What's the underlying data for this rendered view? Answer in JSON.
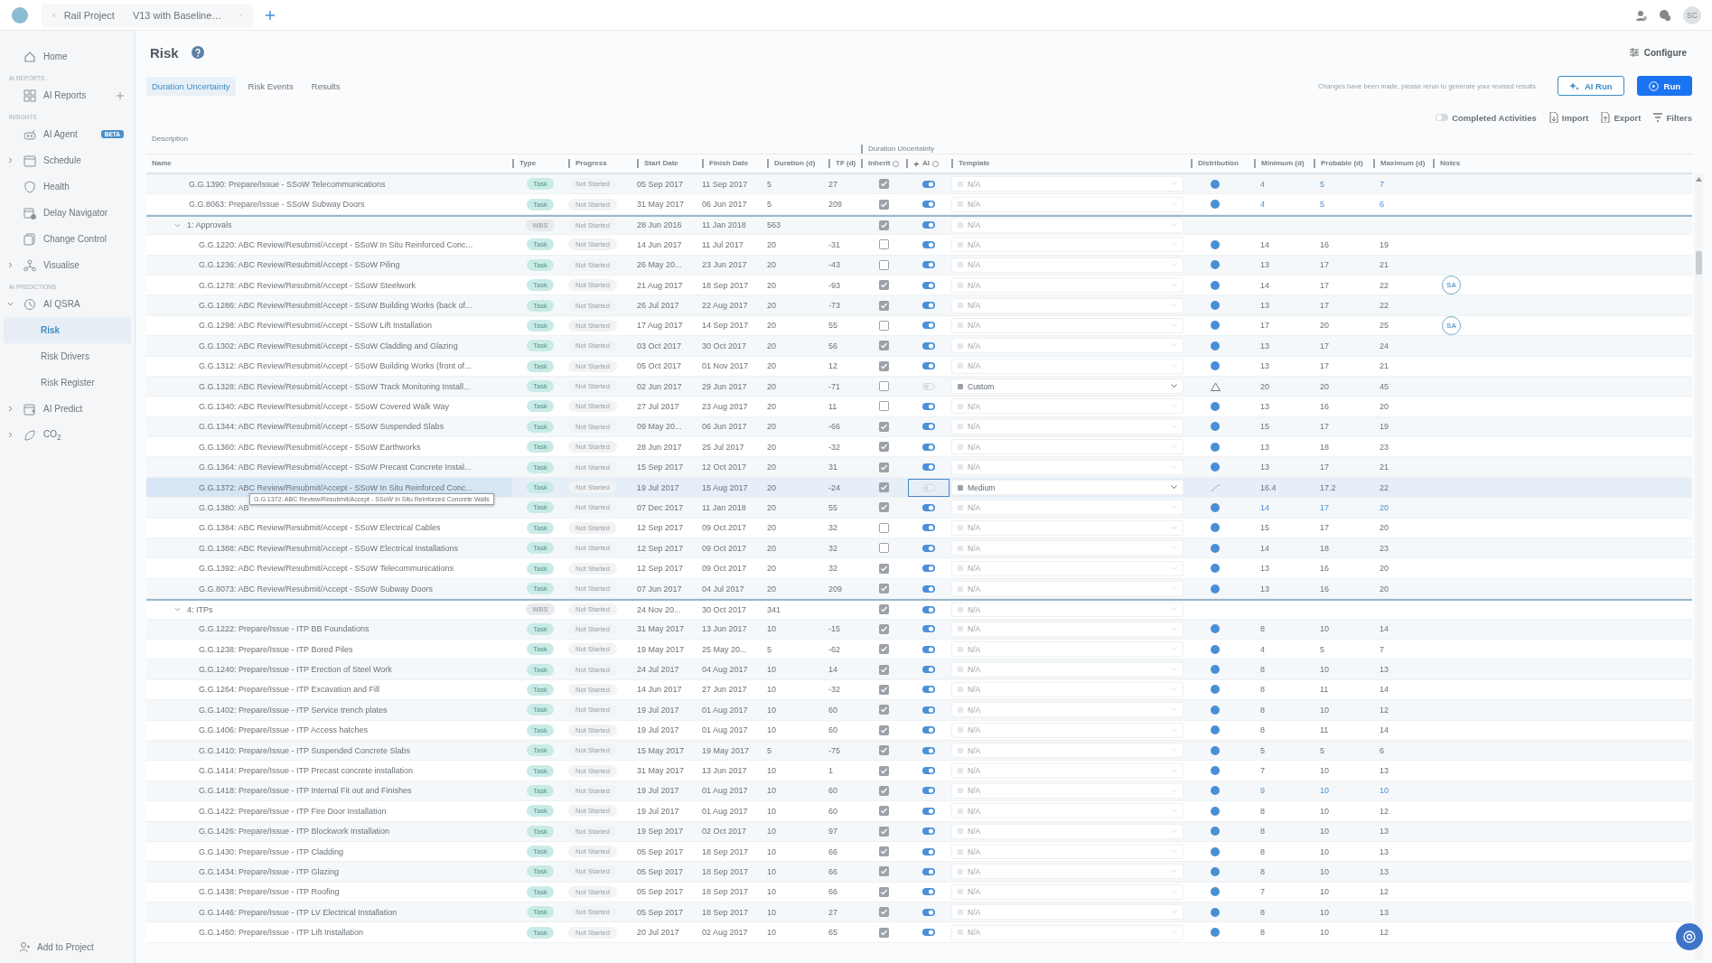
{
  "top_bar": {
    "breadcrumb": [
      "Rail Project",
      "V13 with Baseline…"
    ],
    "avatar": "SC"
  },
  "sidebar": {
    "items": [
      {
        "kind": "link",
        "label": "Home",
        "selected": false
      },
      {
        "kind": "section",
        "label": "AI REPORTS"
      },
      {
        "kind": "link",
        "label": "AI Reports",
        "selected": false,
        "add": true
      },
      {
        "kind": "section",
        "label": "INSIGHTS"
      },
      {
        "kind": "link",
        "label": "AI Agent",
        "selected": false,
        "badge": "BETA"
      },
      {
        "kind": "link",
        "label": "Schedule",
        "selected": false,
        "expanded": false
      },
      {
        "kind": "link",
        "label": "Health",
        "selected": false
      },
      {
        "kind": "link",
        "label": "Delay Navigator",
        "selected": false
      },
      {
        "kind": "link",
        "label": "Change Control",
        "selected": false
      },
      {
        "kind": "link",
        "label": "Visualise",
        "selected": false,
        "expanded": false
      },
      {
        "kind": "section",
        "label": "AI PREDICTIONS"
      },
      {
        "kind": "link",
        "label": "AI QSRA",
        "selected": false,
        "expanded": true,
        "children": [
          {
            "label": "Risk",
            "selected": true
          },
          {
            "label": "Risk Drivers",
            "selected": false
          },
          {
            "label": "Risk Register",
            "selected": false
          }
        ]
      },
      {
        "kind": "link",
        "label": "AI Predict",
        "selected": false,
        "expanded": false
      },
      {
        "kind": "link",
        "label": "CO$_{2}$",
        "selected": false,
        "expanded": false
      }
    ],
    "footer": "Add to Project"
  },
  "header": {
    "title": "Risk",
    "configure": "Configure",
    "tabs": [
      {
        "label": "Duration Uncertainty",
        "selected": true
      },
      {
        "label": "Risk Events",
        "selected": false
      },
      {
        "label": "Results",
        "selected": false
      }
    ],
    "message": "Changes have been made, please rerun to generate your revised results",
    "buttons": [
      {
        "label": "AI Run",
        "kind": "outline"
      },
      {
        "label": "Run",
        "kind": "primary"
      }
    ],
    "toolbar": {
      "completed_activities": {
        "label": "Completed Activities",
        "on": false
      },
      "actions": [
        "Import",
        "Export",
        "Filters"
      ]
    }
  },
  "table": {
    "groups": [
      "Description",
      "Duration Uncertainty"
    ],
    "columns": [
      "Name",
      "Type",
      "Progress",
      "Start Date",
      "Finish Date",
      "Duration (d)",
      "TF (d)",
      "Inherit",
      "AI",
      "Template",
      "Distribution",
      "Minimum (d)",
      "Probable (d)",
      "Maximum (d)",
      "Notes"
    ],
    "tooltip": "G.G.1372: ABC Review/Resubmit/Accept - SSoW In Situ Reinforced Concrete Walls",
    "rows": [
      {
        "kind": "task",
        "name": "G.G.1390: Prepare/Issue - SSoW Telecommunications",
        "type": "Task",
        "progress": "Not Started",
        "start": "05 Sep 2017",
        "finish": "11 Sep 2017",
        "duration": "5",
        "tf": "27",
        "inherit": true,
        "ai": true,
        "template": {
          "value": "N/A",
          "disabled": true
        },
        "distribution": {
          "kind": "normal"
        },
        "min": "4",
        "probable": "5",
        "max": "7",
        "edited": true,
        "selected": false
      },
      {
        "kind": "task",
        "name": "G.G.8063: Prepare/Issue - SSoW Subway Doors",
        "type": "Task",
        "progress": "Not Started",
        "start": "31 May 2017",
        "finish": "06 Jun 2017",
        "duration": "5",
        "tf": "209",
        "inherit": true,
        "ai": true,
        "template": {
          "value": "N/A",
          "disabled": true
        },
        "distribution": {
          "kind": "normal"
        },
        "min": "4",
        "probable": "5",
        "max": "6",
        "edited": true,
        "selected": false
      },
      {
        "kind": "wbs",
        "name": "1: Approvals",
        "type": "WBS",
        "progress": "Not Started",
        "start": "28 Jun 2016",
        "finish": "11 Jan 2018",
        "duration": "563",
        "inherit": true,
        "ai": true,
        "template": {
          "value": "N/A",
          "disabled": true
        },
        "expanded": true,
        "selected": false,
        "children": [
          {
            "kind": "task",
            "name": "G.G.1220: ABC Review/Resubmit/Accept - SSoW In Situ Reinforced Conc...",
            "type": "Task",
            "progress": "Not Started",
            "start": "14 Jun 2017",
            "finish": "11 Jul 2017",
            "duration": "20",
            "tf": "-31",
            "inherit": false,
            "ai": true,
            "template": {
              "value": "N/A",
              "disabled": true
            },
            "distribution": {
              "kind": "normal"
            },
            "min": "14",
            "probable": "16",
            "max": "19",
            "edited": false,
            "selected": false
          },
          {
            "kind": "task",
            "name": "G.G.1236: ABC Review/Resubmit/Accept - SSoW Piling",
            "type": "Task",
            "progress": "Not Started",
            "start": "26 May 20...",
            "finish": "23 Jun 2017",
            "duration": "20",
            "tf": "-43",
            "inherit": false,
            "ai": true,
            "template": {
              "value": "N/A",
              "disabled": true
            },
            "distribution": {
              "kind": "normal"
            },
            "min": "13",
            "probable": "17",
            "max": "21",
            "edited": false,
            "selected": false
          },
          {
            "kind": "task",
            "name": "G.G.1278: ABC Review/Resubmit/Accept - SSoW Steelwork",
            "type": "Task",
            "progress": "Not Started",
            "start": "21 Aug 2017",
            "finish": "18 Sep 2017",
            "duration": "20",
            "tf": "-93",
            "inherit": true,
            "ai": true,
            "template": {
              "value": "N/A",
              "disabled": true
            },
            "distribution": {
              "kind": "normal"
            },
            "min": "14",
            "probable": "17",
            "max": "22",
            "note": "SA",
            "edited": false,
            "selected": false
          },
          {
            "kind": "task",
            "name": "G.G.1286: ABC Review/Resubmit/Accept - SSoW Building Works (back of...",
            "type": "Task",
            "progress": "Not Started",
            "start": "26 Jul 2017",
            "finish": "22 Aug 2017",
            "duration": "20",
            "tf": "-73",
            "inherit": true,
            "ai": true,
            "template": {
              "value": "N/A",
              "disabled": true
            },
            "distribution": {
              "kind": "normal"
            },
            "min": "13",
            "probable": "17",
            "max": "22",
            "edited": false,
            "selected": false
          },
          {
            "kind": "task",
            "name": "G.G.1298: ABC Review/Resubmit/Accept - SSoW Lift Installation",
            "type": "Task",
            "progress": "Not Started",
            "start": "17 Aug 2017",
            "finish": "14 Sep 2017",
            "duration": "20",
            "tf": "55",
            "inherit": false,
            "ai": true,
            "template": {
              "value": "N/A",
              "disabled": true
            },
            "distribution": {
              "kind": "normal"
            },
            "min": "17",
            "probable": "20",
            "max": "25",
            "note": "SA",
            "edited": false,
            "selected": false
          },
          {
            "kind": "task",
            "name": "G.G.1302: ABC Review/Resubmit/Accept - SSoW Cladding and Glazing",
            "type": "Task",
            "progress": "Not Started",
            "start": "03 Oct 2017",
            "finish": "30 Oct 2017",
            "duration": "20",
            "tf": "56",
            "inherit": true,
            "ai": true,
            "template": {
              "value": "N/A",
              "disabled": true
            },
            "distribution": {
              "kind": "normal"
            },
            "min": "13",
            "probable": "17",
            "max": "24",
            "edited": false,
            "selected": false
          },
          {
            "kind": "task",
            "name": "G.G.1312: ABC Review/Resubmit/Accept - SSoW Building Works (front of...",
            "type": "Task",
            "progress": "Not Started",
            "start": "05 Oct 2017",
            "finish": "01 Nov 2017",
            "duration": "20",
            "tf": "12",
            "inherit": true,
            "ai": true,
            "template": {
              "value": "N/A",
              "disabled": true
            },
            "distribution": {
              "kind": "normal"
            },
            "min": "13",
            "probable": "17",
            "max": "21",
            "edited": false,
            "selected": false
          },
          {
            "kind": "task",
            "name": "G.G.1328: ABC Review/Resubmit/Accept - SSoW Track Monitoring Install...",
            "type": "Task",
            "progress": "Not Started",
            "start": "02 Jun 2017",
            "finish": "29 Jun 2017",
            "duration": "20",
            "tf": "-71",
            "inherit": false,
            "ai": false,
            "template": {
              "value": "Custom",
              "disabled": false
            },
            "distribution": {
              "kind": "triangle"
            },
            "min": "20",
            "probable": "20",
            "max": "45",
            "edited": false,
            "selected": false
          },
          {
            "kind": "task",
            "name": "G.G.1340: ABC Review/Resubmit/Accept - SSoW Covered Walk Way",
            "type": "Task",
            "progress": "Not Started",
            "start": "27 Jul 2017",
            "finish": "23 Aug 2017",
            "duration": "20",
            "tf": "11",
            "inherit": false,
            "ai": true,
            "template": {
              "value": "N/A",
              "disabled": true
            },
            "distribution": {
              "kind": "normal"
            },
            "min": "13",
            "probable": "16",
            "max": "20",
            "edited": false,
            "selected": false
          },
          {
            "kind": "task",
            "name": "G.G.1344: ABC Review/Resubmit/Accept - SSoW Suspended Slabs",
            "type": "Task",
            "progress": "Not Started",
            "start": "09 May 20...",
            "finish": "06 Jun 2017",
            "duration": "20",
            "tf": "-66",
            "inherit": true,
            "ai": true,
            "template": {
              "value": "N/A",
              "disabled": true
            },
            "distribution": {
              "kind": "normal"
            },
            "min": "15",
            "probable": "17",
            "max": "19",
            "edited": false,
            "selected": false
          },
          {
            "kind": "task",
            "name": "G.G.1360: ABC Review/Resubmit/Accept - SSoW Earthworks",
            "type": "Task",
            "progress": "Not Started",
            "start": "28 Jun 2017",
            "finish": "25 Jul 2017",
            "duration": "20",
            "tf": "-32",
            "inherit": true,
            "ai": true,
            "template": {
              "value": "N/A",
              "disabled": true
            },
            "distribution": {
              "kind": "normal"
            },
            "min": "13",
            "probable": "18",
            "max": "23",
            "edited": false,
            "selected": false
          },
          {
            "kind": "task",
            "name": "G.G.1364: ABC Review/Resubmit/Accept - SSoW Precast Concrete Instal...",
            "type": "Task",
            "progress": "Not Started",
            "start": "15 Sep 2017",
            "finish": "12 Oct 2017",
            "duration": "20",
            "tf": "31",
            "inherit": true,
            "ai": true,
            "template": {
              "value": "N/A",
              "disabled": true
            },
            "distribution": {
              "kind": "normal"
            },
            "min": "13",
            "probable": "17",
            "max": "21",
            "edited": false,
            "selected": false
          },
          {
            "kind": "task",
            "name": "G.G.1372: ABC Review/Resubmit/Accept - SSoW In Situ Reinforced Conc...",
            "type": "Task",
            "progress": "Not Started",
            "start": "19 Jul 2017",
            "finish": "15 Aug 2017",
            "duration": "20",
            "tf": "-24",
            "inherit": true,
            "ai": false,
            "template": {
              "value": "Medium",
              "disabled": false
            },
            "distribution": {
              "kind": "curve"
            },
            "min": "16.4",
            "probable": "17.2",
            "max": "22",
            "edited": false,
            "selected": true
          },
          {
            "kind": "task",
            "name": "G.G.1380: AB",
            "type": "Task",
            "progress": "Not Started",
            "start": "07 Dec 2017",
            "finish": "11 Jan 2018",
            "duration": "20",
            "tf": "55",
            "inherit": true,
            "ai": true,
            "template": {
              "value": "N/A",
              "disabled": true
            },
            "distribution": {
              "kind": "normal"
            },
            "min": "14",
            "probable": "17",
            "max": "20",
            "edited": true,
            "selected": false
          },
          {
            "kind": "task",
            "name": "G.G.1384: ABC Review/Resubmit/Accept - SSoW Electrical Cables",
            "type": "Task",
            "progress": "Not Started",
            "start": "12 Sep 2017",
            "finish": "09 Oct 2017",
            "duration": "20",
            "tf": "32",
            "inherit": false,
            "ai": true,
            "template": {
              "value": "N/A",
              "disabled": true
            },
            "distribution": {
              "kind": "normal"
            },
            "min": "15",
            "probable": "17",
            "max": "20",
            "edited": false,
            "selected": false
          },
          {
            "kind": "task",
            "name": "G.G.1388: ABC Review/Resubmit/Accept - SSoW Electrical Installations",
            "type": "Task",
            "progress": "Not Started",
            "start": "12 Sep 2017",
            "finish": "09 Oct 2017",
            "duration": "20",
            "tf": "32",
            "inherit": false,
            "ai": true,
            "template": {
              "value": "N/A",
              "disabled": true
            },
            "distribution": {
              "kind": "normal"
            },
            "min": "14",
            "probable": "18",
            "max": "23",
            "edited": false,
            "selected": false
          },
          {
            "kind": "task",
            "name": "G.G.1392: ABC Review/Resubmit/Accept - SSoW Telecommunications",
            "type": "Task",
            "progress": "Not Started",
            "start": "12 Sep 2017",
            "finish": "09 Oct 2017",
            "duration": "20",
            "tf": "32",
            "inherit": true,
            "ai": true,
            "template": {
              "value": "N/A",
              "disabled": true
            },
            "distribution": {
              "kind": "normal"
            },
            "min": "13",
            "probable": "16",
            "max": "20",
            "edited": false,
            "selected": false
          },
          {
            "kind": "task",
            "name": "G.G.8073: ABC Review/Resubmit/Accept - SSoW Subway Doors",
            "type": "Task",
            "progress": "Not Started",
            "start": "07 Jun 2017",
            "finish": "04 Jul 2017",
            "duration": "20",
            "tf": "209",
            "inherit": true,
            "ai": true,
            "template": {
              "value": "N/A",
              "disabled": true
            },
            "distribution": {
              "kind": "normal"
            },
            "min": "13",
            "probable": "16",
            "max": "20",
            "edited": false,
            "selected": false
          }
        ]
      },
      {
        "kind": "wbs",
        "name": "4: ITPs",
        "type": "WBS",
        "progress": "Not Started",
        "start": "24 Nov 20...",
        "finish": "30 Oct 2017",
        "duration": "341",
        "inherit": true,
        "ai": true,
        "template": {
          "value": "N/A",
          "disabled": true
        },
        "expanded": true,
        "selected": false,
        "children": [
          {
            "kind": "task",
            "name": "G.G.1222: Prepare/Issue - ITP BB Foundations",
            "type": "Task",
            "progress": "Not Started",
            "start": "31 May 2017",
            "finish": "13 Jun 2017",
            "duration": "10",
            "tf": "-15",
            "inherit": true,
            "ai": true,
            "template": {
              "value": "N/A",
              "disabled": true
            },
            "distribution": {
              "kind": "normal"
            },
            "min": "8",
            "probable": "10",
            "max": "14",
            "edited": false,
            "selected": false
          },
          {
            "kind": "task",
            "name": "G.G.1238: Prepare/Issue - ITP Bored Piles",
            "type": "Task",
            "progress": "Not Started",
            "start": "19 May 2017",
            "finish": "25 May 20...",
            "duration": "5",
            "tf": "-62",
            "inherit": true,
            "ai": true,
            "template": {
              "value": "N/A",
              "disabled": true
            },
            "distribution": {
              "kind": "normal"
            },
            "min": "4",
            "probable": "5",
            "max": "7",
            "edited": false,
            "selected": false
          },
          {
            "kind": "task",
            "name": "G.G.1240: Prepare/Issue - ITP Erection of Steel Work",
            "type": "Task",
            "progress": "Not Started",
            "start": "24 Jul 2017",
            "finish": "04 Aug 2017",
            "duration": "10",
            "tf": "14",
            "inherit": true,
            "ai": true,
            "template": {
              "value": "N/A",
              "disabled": true
            },
            "distribution": {
              "kind": "normal"
            },
            "min": "8",
            "probable": "10",
            "max": "13",
            "edited": false,
            "selected": false
          },
          {
            "kind": "task",
            "name": "G.G.1264: Prepare/Issue - ITP Excavation and Fill",
            "type": "Task",
            "progress": "Not Started",
            "start": "14 Jun 2017",
            "finish": "27 Jun 2017",
            "duration": "10",
            "tf": "-32",
            "inherit": true,
            "ai": true,
            "template": {
              "value": "N/A",
              "disabled": true
            },
            "distribution": {
              "kind": "normal"
            },
            "min": "8",
            "probable": "11",
            "max": "14",
            "edited": false,
            "selected": false
          },
          {
            "kind": "task",
            "name": "G.G.1402: Prepare/Issue - ITP Service trench plates",
            "type": "Task",
            "progress": "Not Started",
            "start": "19 Jul 2017",
            "finish": "01 Aug 2017",
            "duration": "10",
            "tf": "60",
            "inherit": true,
            "ai": true,
            "template": {
              "value": "N/A",
              "disabled": true
            },
            "distribution": {
              "kind": "normal"
            },
            "min": "8",
            "probable": "10",
            "max": "12",
            "edited": false,
            "selected": false
          },
          {
            "kind": "task",
            "name": "G.G.1406: Prepare/Issue - ITP Access hatches",
            "type": "Task",
            "progress": "Not Started",
            "start": "19 Jul 2017",
            "finish": "01 Aug 2017",
            "duration": "10",
            "tf": "60",
            "inherit": true,
            "ai": true,
            "template": {
              "value": "N/A",
              "disabled": true
            },
            "distribution": {
              "kind": "normal"
            },
            "min": "8",
            "probable": "11",
            "max": "14",
            "edited": false,
            "selected": false
          },
          {
            "kind": "task",
            "name": "G.G.1410: Prepare/Issue - ITP Suspended Concrete Slabs",
            "type": "Task",
            "progress": "Not Started",
            "start": "15 May 2017",
            "finish": "19 May 2017",
            "duration": "5",
            "tf": "-75",
            "inherit": true,
            "ai": true,
            "template": {
              "value": "N/A",
              "disabled": true
            },
            "distribution": {
              "kind": "normal"
            },
            "min": "5",
            "probable": "5",
            "max": "6",
            "edited": false,
            "selected": false
          },
          {
            "kind": "task",
            "name": "G.G.1414: Prepare/Issue - ITP Precast concrete installation",
            "type": "Task",
            "progress": "Not Started",
            "start": "31 May 2017",
            "finish": "13 Jun 2017",
            "duration": "10",
            "tf": "1",
            "inherit": true,
            "ai": true,
            "template": {
              "value": "N/A",
              "disabled": true
            },
            "distribution": {
              "kind": "normal"
            },
            "min": "7",
            "probable": "10",
            "max": "13",
            "edited": false,
            "selected": false
          },
          {
            "kind": "task",
            "name": "G.G.1418: Prepare/Issue - ITP Internal Fit out and Finishes",
            "type": "Task",
            "progress": "Not Started",
            "start": "19 Jul 2017",
            "finish": "01 Aug 2017",
            "duration": "10",
            "tf": "60",
            "inherit": true,
            "ai": true,
            "template": {
              "value": "N/A",
              "disabled": true
            },
            "distribution": {
              "kind": "normal"
            },
            "min": "9",
            "probable": "10",
            "max": "10",
            "edited": true,
            "selected": false
          },
          {
            "kind": "task",
            "name": "G.G.1422: Prepare/Issue - ITP Fire Door Installation",
            "type": "Task",
            "progress": "Not Started",
            "start": "19 Jul 2017",
            "finish": "01 Aug 2017",
            "duration": "10",
            "tf": "60",
            "inherit": true,
            "ai": true,
            "template": {
              "value": "N/A",
              "disabled": true
            },
            "distribution": {
              "kind": "normal"
            },
            "min": "8",
            "probable": "10",
            "max": "12",
            "edited": false,
            "selected": false
          },
          {
            "kind": "task",
            "name": "G.G.1426: Prepare/Issue - ITP Blockwork Installation",
            "type": "Task",
            "progress": "Not Started",
            "start": "19 Sep 2017",
            "finish": "02 Oct 2017",
            "duration": "10",
            "tf": "97",
            "inherit": true,
            "ai": true,
            "template": {
              "value": "N/A",
              "disabled": true
            },
            "distribution": {
              "kind": "normal"
            },
            "min": "8",
            "probable": "10",
            "max": "13",
            "edited": false,
            "selected": false
          },
          {
            "kind": "task",
            "name": "G.G.1430: Prepare/Issue - ITP Cladding",
            "type": "Task",
            "progress": "Not Started",
            "start": "05 Sep 2017",
            "finish": "18 Sep 2017",
            "duration": "10",
            "tf": "66",
            "inherit": true,
            "ai": true,
            "template": {
              "value": "N/A",
              "disabled": true
            },
            "distribution": {
              "kind": "normal"
            },
            "min": "8",
            "probable": "10",
            "max": "13",
            "edited": false,
            "selected": false
          },
          {
            "kind": "task",
            "name": "G.G.1434: Prepare/Issue - ITP Glazing",
            "type": "Task",
            "progress": "Not Started",
            "start": "05 Sep 2017",
            "finish": "18 Sep 2017",
            "duration": "10",
            "tf": "66",
            "inherit": true,
            "ai": true,
            "template": {
              "value": "N/A",
              "disabled": true
            },
            "distribution": {
              "kind": "normal"
            },
            "min": "8",
            "probable": "10",
            "max": "13",
            "edited": false,
            "selected": false
          },
          {
            "kind": "task",
            "name": "G.G.1438: Prepare/Issue - ITP Roofing",
            "type": "Task",
            "progress": "Not Started",
            "start": "05 Sep 2017",
            "finish": "18 Sep 2017",
            "duration": "10",
            "tf": "66",
            "inherit": true,
            "ai": true,
            "template": {
              "value": "N/A",
              "disabled": true
            },
            "distribution": {
              "kind": "normal"
            },
            "min": "7",
            "probable": "10",
            "max": "12",
            "edited": false,
            "selected": false
          },
          {
            "kind": "task",
            "name": "G.G.1446: Prepare/Issue - ITP LV Electrical Installation",
            "type": "Task",
            "progress": "Not Started",
            "start": "05 Sep 2017",
            "finish": "18 Sep 2017",
            "duration": "10",
            "tf": "27",
            "inherit": true,
            "ai": true,
            "template": {
              "value": "N/A",
              "disabled": true
            },
            "distribution": {
              "kind": "normal"
            },
            "min": "8",
            "probable": "10",
            "max": "13",
            "edited": false,
            "selected": false
          },
          {
            "kind": "task",
            "name": "G.G.1450: Prepare/Issue - ITP Lift Installation",
            "type": "Task",
            "progress": "Not Started",
            "start": "20 Jul 2017",
            "finish": "02 Aug 2017",
            "duration": "10",
            "tf": "65",
            "inherit": true,
            "ai": true,
            "template": {
              "value": "N/A",
              "disabled": true
            },
            "distribution": {
              "kind": "normal"
            },
            "min": "8",
            "probable": "10",
            "max": "12",
            "edited": false,
            "selected": false
          }
        ]
      }
    ]
  }
}
